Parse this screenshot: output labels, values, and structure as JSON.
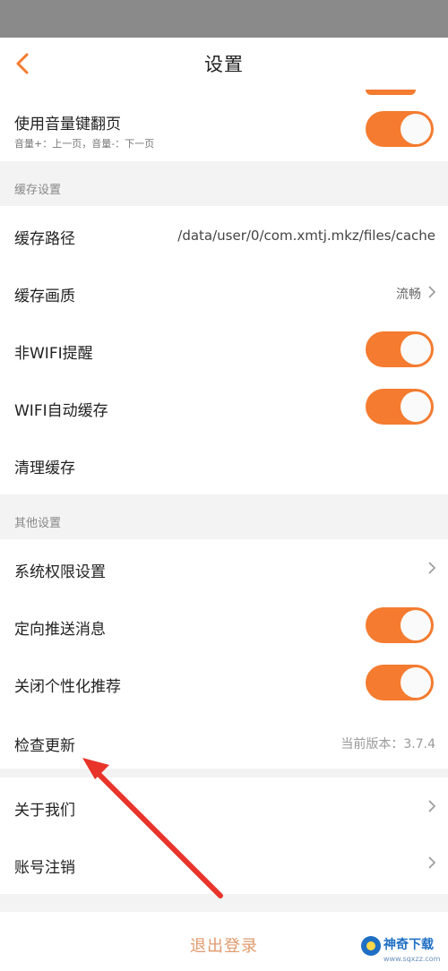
{
  "header": {
    "title": "设置"
  },
  "volume_row": {
    "label": "使用音量键翻页",
    "sub": "音量+：上一页，音量-：下一页",
    "on": true
  },
  "cache_section": {
    "title": "缓存设置",
    "path_label": "缓存路径",
    "path_value": "/data/user/0/com.xmtj.mkz/files/cache",
    "quality_label": "缓存画质",
    "quality_value": "流畅",
    "nonwifi_label": "非WIFI提醒",
    "wifi_auto_label": "WIFI自动缓存",
    "clear_label": "清理缓存"
  },
  "other_section": {
    "title": "其他设置",
    "perm_label": "系统权限设置",
    "push_label": "定向推送消息",
    "personal_label": "关闭个性化推荐",
    "update_label": "检查更新",
    "version_text": "当前版本：3.7.4"
  },
  "about": {
    "about_label": "关于我们",
    "cancel_label": "账号注销"
  },
  "logout": {
    "label": "退出登录"
  },
  "watermark": {
    "title": "神奇下载",
    "url": "www.sqxzz.com"
  },
  "colors": {
    "accent": "#f47b2f",
    "arrow": "#e8342a"
  }
}
